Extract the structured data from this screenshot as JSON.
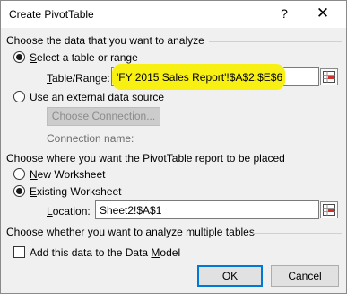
{
  "window": {
    "title": "Create PivotTable",
    "help_label": "?",
    "close_label": "✕"
  },
  "section_analyze": {
    "title": "Choose the data that you want to analyze",
    "select_range": {
      "prefix": "",
      "key": "S",
      "rest": "elect a table or range",
      "checked": true
    },
    "table_range": {
      "key": "T",
      "rest": "able/Range:",
      "value": "'FY 2015 Sales Report'!$A$2:$E$6",
      "highlight_color": "#f7f012"
    },
    "external": {
      "key": "U",
      "rest": "se an external data source",
      "checked": false
    },
    "choose_connection_label": "Choose Connection...",
    "connection_name_label": "Connection name:"
  },
  "section_placement": {
    "title": "Choose where you want the PivotTable report to be placed",
    "new_worksheet": {
      "key": "N",
      "rest": "ew Worksheet",
      "checked": false
    },
    "existing_worksheet": {
      "key": "E",
      "rest": "xisting Worksheet",
      "checked": true
    },
    "location": {
      "key": "L",
      "rest": "ocation:",
      "value": "Sheet2!$A$1"
    }
  },
  "section_multiple": {
    "title": "Choose whether you want to analyze multiple tables",
    "data_model": {
      "prefix": "Add this data to the Data ",
      "key": "M",
      "rest": "odel",
      "checked": false
    }
  },
  "buttons": {
    "ok": "OK",
    "cancel": "Cancel"
  },
  "icons": {
    "refedit": "range-selector-icon"
  }
}
